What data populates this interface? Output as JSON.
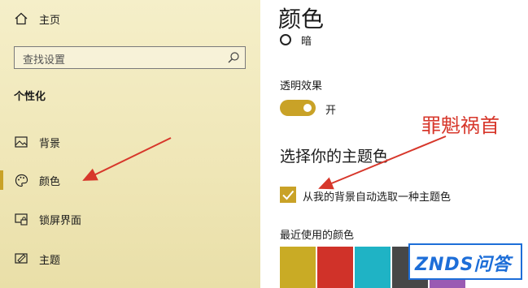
{
  "sidebar": {
    "home_label": "主页",
    "search_placeholder": "查找设置",
    "section_title": "个性化",
    "items": [
      {
        "label": "背景",
        "icon": "image-icon"
      },
      {
        "label": "颜色",
        "icon": "palette-icon",
        "selected": true
      },
      {
        "label": "锁屏界面",
        "icon": "lock-screen-icon"
      },
      {
        "label": "主题",
        "icon": "theme-icon"
      }
    ]
  },
  "main": {
    "title": "颜色",
    "dark_option_label": "暗",
    "transparency_label": "透明效果",
    "transparency_state": "开",
    "theme_color_heading": "选择你的主题色",
    "auto_pick_label": "从我的背景自动选取一种主题色",
    "recent_colors_label": "最近使用的颜色",
    "recent_colors": [
      "#c9ab25",
      "#d03229",
      "#1fb3c5",
      "#474747",
      "#9a5bb3"
    ]
  },
  "annotation": {
    "text": "罪魁祸首"
  },
  "watermark": {
    "text": "ZNDS问答"
  },
  "colors": {
    "accent": "#c9a227",
    "arrow": "#d7372b"
  }
}
